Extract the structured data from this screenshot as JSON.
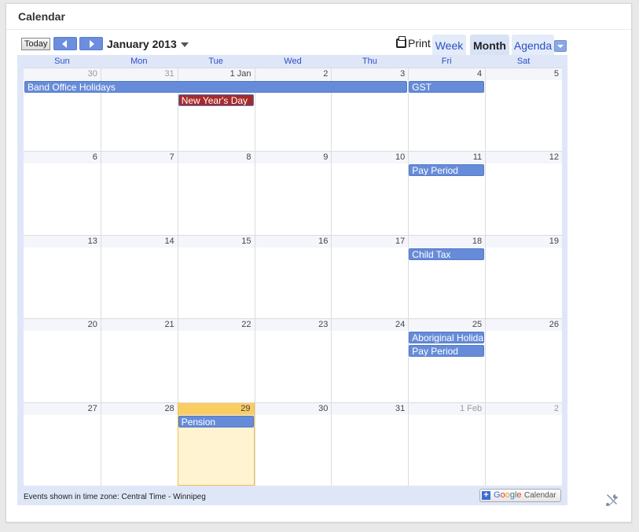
{
  "widget": {
    "title": "Calendar"
  },
  "toolbar": {
    "today_label": "Today",
    "month_title": "January 2013",
    "print_label": "Print",
    "tabs": {
      "week": "Week",
      "month": "Month",
      "agenda": "Agenda"
    },
    "active_tab": "Month"
  },
  "weekdays": [
    "Sun",
    "Mon",
    "Tue",
    "Wed",
    "Thu",
    "Fri",
    "Sat"
  ],
  "weeks": [
    [
      {
        "day": "30",
        "other": true
      },
      {
        "day": "31",
        "other": true
      },
      {
        "day": "1 Jan"
      },
      {
        "day": "2"
      },
      {
        "day": "3"
      },
      {
        "day": "4"
      },
      {
        "day": "5"
      }
    ],
    [
      {
        "day": "6"
      },
      {
        "day": "7"
      },
      {
        "day": "8"
      },
      {
        "day": "9"
      },
      {
        "day": "10"
      },
      {
        "day": "11"
      },
      {
        "day": "12"
      }
    ],
    [
      {
        "day": "13"
      },
      {
        "day": "14"
      },
      {
        "day": "15"
      },
      {
        "day": "16"
      },
      {
        "day": "17"
      },
      {
        "day": "18"
      },
      {
        "day": "19"
      }
    ],
    [
      {
        "day": "20"
      },
      {
        "day": "21"
      },
      {
        "day": "22"
      },
      {
        "day": "23"
      },
      {
        "day": "24"
      },
      {
        "day": "25"
      },
      {
        "day": "26"
      }
    ],
    [
      {
        "day": "27"
      },
      {
        "day": "28"
      },
      {
        "day": "29",
        "today": true
      },
      {
        "day": "30"
      },
      {
        "day": "31"
      },
      {
        "day": "1 Feb",
        "other": true
      },
      {
        "day": "2",
        "other": true
      }
    ]
  ],
  "events": [
    {
      "title": "Band Office Holidays",
      "week": 0,
      "start": 0,
      "span": 5,
      "slot": 0,
      "color": "#668cd9"
    },
    {
      "title": "GST",
      "week": 0,
      "start": 5,
      "span": 1,
      "slot": 0,
      "color": "#668cd9"
    },
    {
      "title": "New Year's Day",
      "week": 0,
      "start": 2,
      "span": 1,
      "slot": 1,
      "color": "#a72a2a"
    },
    {
      "title": "Pay Period",
      "week": 1,
      "start": 5,
      "span": 1,
      "slot": 0,
      "color": "#668cd9"
    },
    {
      "title": "Child Tax",
      "week": 2,
      "start": 5,
      "span": 1,
      "slot": 0,
      "color": "#668cd9"
    },
    {
      "title": "Aboriginal Holiday",
      "week": 3,
      "start": 5,
      "span": 1,
      "slot": 0,
      "color": "#668cd9"
    },
    {
      "title": "Pay Period",
      "week": 3,
      "start": 5,
      "span": 1,
      "slot": 1,
      "color": "#668cd9"
    },
    {
      "title": "Pension",
      "week": 4,
      "start": 2,
      "span": 1,
      "slot": 0,
      "color": "#668cd9"
    }
  ],
  "footer": {
    "timezone_text": "Events shown in time zone: Central Time - Winnipeg",
    "gcal_brand": "Google",
    "gcal_word": "Calendar"
  },
  "icons": {
    "tools": "tools-icon"
  }
}
